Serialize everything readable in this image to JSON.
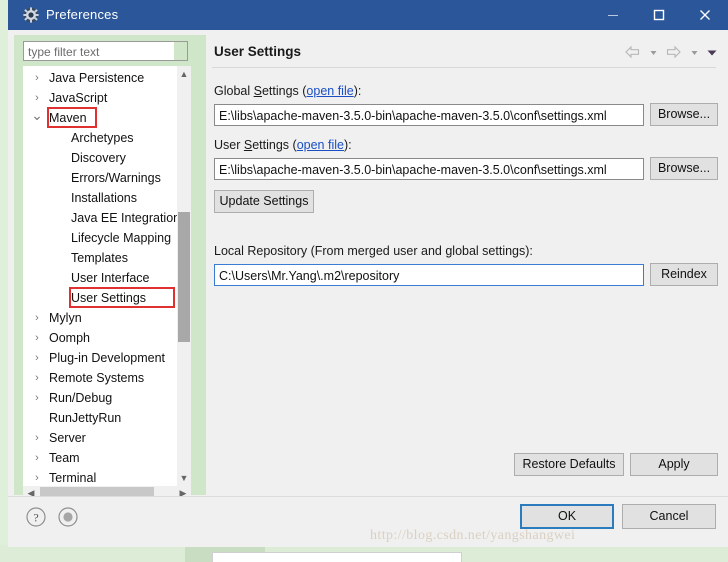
{
  "window": {
    "title": "Preferences",
    "icon": "gear-icon",
    "minimize_label": "–",
    "maximize_label": "□",
    "close_label": "✕"
  },
  "sidebar": {
    "filter": {
      "placeholder": "type filter text",
      "value": ""
    },
    "items": [
      {
        "label": "Java Persistence",
        "level": 1,
        "expandable": true,
        "expanded": false
      },
      {
        "label": "JavaScript",
        "level": 1,
        "expandable": true,
        "expanded": false
      },
      {
        "label": "Maven",
        "level": 1,
        "expandable": true,
        "expanded": true,
        "highlight": true
      },
      {
        "label": "Archetypes",
        "level": 2,
        "expandable": false,
        "expanded": false
      },
      {
        "label": "Discovery",
        "level": 2,
        "expandable": false,
        "expanded": false
      },
      {
        "label": "Errors/Warnings",
        "level": 2,
        "expandable": false,
        "expanded": false
      },
      {
        "label": "Installations",
        "level": 2,
        "expandable": false,
        "expanded": false
      },
      {
        "label": "Java EE Integration",
        "level": 2,
        "expandable": false,
        "expanded": false
      },
      {
        "label": "Lifecycle Mapping",
        "level": 2,
        "expandable": false,
        "expanded": false
      },
      {
        "label": "Templates",
        "level": 2,
        "expandable": false,
        "expanded": false
      },
      {
        "label": "User Interface",
        "level": 2,
        "expandable": false,
        "expanded": false
      },
      {
        "label": "User Settings",
        "level": 2,
        "expandable": false,
        "expanded": false,
        "highlight": true,
        "selected": true
      },
      {
        "label": "Mylyn",
        "level": 1,
        "expandable": true,
        "expanded": false
      },
      {
        "label": "Oomph",
        "level": 1,
        "expandable": true,
        "expanded": false
      },
      {
        "label": "Plug-in Development",
        "level": 1,
        "expandable": true,
        "expanded": false
      },
      {
        "label": "Remote Systems",
        "level": 1,
        "expandable": true,
        "expanded": false
      },
      {
        "label": "Run/Debug",
        "level": 1,
        "expandable": true,
        "expanded": false
      },
      {
        "label": "RunJettyRun",
        "level": 1,
        "expandable": false,
        "expanded": false
      },
      {
        "label": "Server",
        "level": 1,
        "expandable": true,
        "expanded": false
      },
      {
        "label": "Team",
        "level": 1,
        "expandable": true,
        "expanded": false
      },
      {
        "label": "Terminal",
        "level": 1,
        "expandable": true,
        "expanded": false
      }
    ],
    "scroll_up_icon": "chevron-up-icon",
    "scroll_down_icon": "chevron-down-icon",
    "scroll_left_icon": "chevron-left-icon",
    "scroll_right_icon": "chevron-right-icon"
  },
  "content": {
    "title": "User Settings",
    "nav": {
      "back_icon": "back-arrow-icon",
      "back_menu_icon": "chevron-down-icon",
      "forward_icon": "forward-arrow-icon",
      "forward_menu_icon": "chevron-down-icon",
      "view_menu_icon": "chevron-down-icon"
    },
    "global_settings": {
      "label_prefix": "Global ",
      "label_accel": "S",
      "label_suffix": "ettings (",
      "link": "open file",
      "label_end": "):",
      "value": "E:\\libs\\apache-maven-3.5.0-bin\\apache-maven-3.5.0\\conf\\settings.xml",
      "browse_label": "Browse..."
    },
    "user_settings": {
      "label_prefix": "User ",
      "label_accel": "S",
      "label_suffix": "ettings (",
      "link": "open file",
      "label_end": "):",
      "value": "E:\\libs\\apache-maven-3.5.0-bin\\apache-maven-3.5.0\\conf\\settings.xml",
      "browse_label": "Browse..."
    },
    "update_settings_label": "Update Settings",
    "local_repository": {
      "label": "Local Repository (From merged user and global settings):",
      "value": "C:\\Users\\Mr.Yang\\.m2\\repository",
      "reindex_label": "Reindex"
    },
    "restore_defaults_label": "Restore Defaults",
    "apply_label": "Apply"
  },
  "footer": {
    "help_icon": "question-mark-icon",
    "secondary_icon": "circle-icon",
    "ok_label": "OK",
    "cancel_label": "Cancel"
  },
  "watermark": "http://blog.csdn.net/yangshangwei",
  "colors": {
    "titlebar": "#2b579a",
    "panel_green": "#cfe7c8",
    "annotation_red": "#e03030",
    "link_blue": "#1a4fc4",
    "focus_blue": "#2b7bbf"
  }
}
